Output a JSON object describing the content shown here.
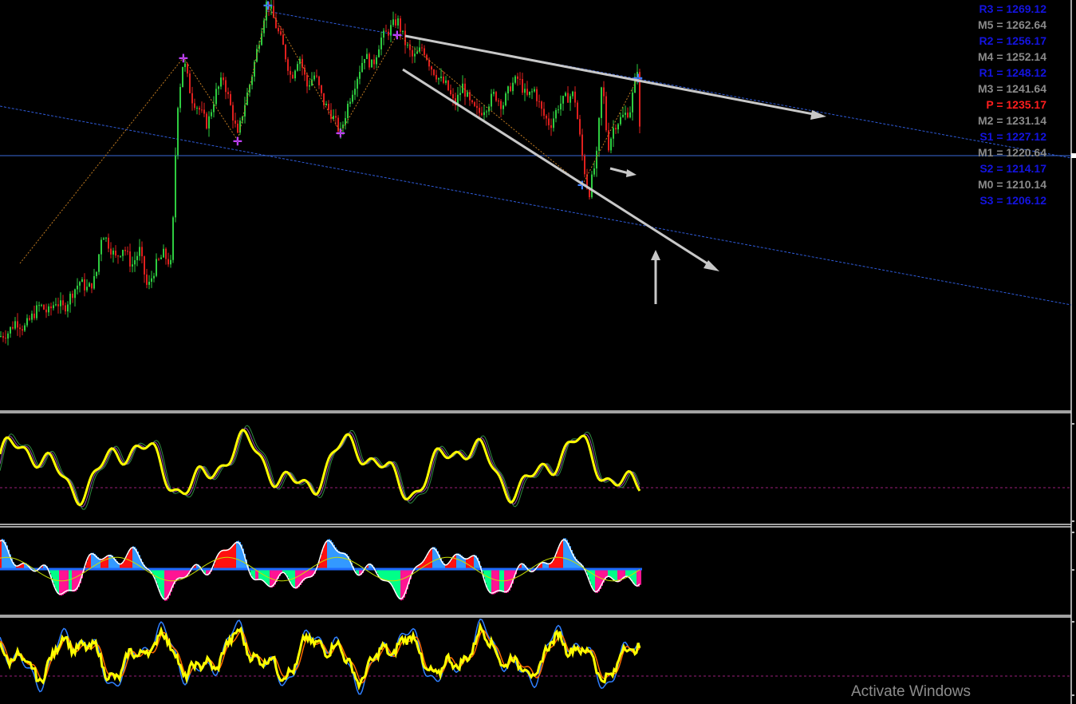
{
  "chart_data": [
    {
      "type": "candlestick",
      "panel": "price",
      "grid": false,
      "legend": "none",
      "colors": {
        "up": "#2ecc40",
        "down": "#e0201e",
        "background": "#000000",
        "channel": "#2f5bd9",
        "zigzag": "#c07a20"
      },
      "price_range": [
        1190,
        1290
      ],
      "close_path": [
        [
          0,
          1204
        ],
        [
          10,
          1205
        ],
        [
          20,
          1208
        ],
        [
          30,
          1206
        ],
        [
          40,
          1209
        ],
        [
          50,
          1212
        ],
        [
          60,
          1210
        ],
        [
          70,
          1213
        ],
        [
          80,
          1211
        ],
        [
          90,
          1215
        ],
        [
          100,
          1218
        ],
        [
          110,
          1216
        ],
        [
          120,
          1219
        ],
        [
          128,
          1231
        ],
        [
          135,
          1228
        ],
        [
          145,
          1224
        ],
        [
          155,
          1227
        ],
        [
          165,
          1222
        ],
        [
          175,
          1226
        ],
        [
          185,
          1216
        ],
        [
          195,
          1222
        ],
        [
          205,
          1225
        ],
        [
          215,
          1222
        ],
        [
          222,
          1262
        ],
        [
          230,
          1275
        ],
        [
          240,
          1265
        ],
        [
          250,
          1262
        ],
        [
          260,
          1258
        ],
        [
          270,
          1266
        ],
        [
          280,
          1270
        ],
        [
          290,
          1262
        ],
        [
          298,
          1255
        ],
        [
          305,
          1262
        ],
        [
          315,
          1270
        ],
        [
          325,
          1280
        ],
        [
          335,
          1290
        ],
        [
          345,
          1284
        ],
        [
          355,
          1278
        ],
        [
          365,
          1270
        ],
        [
          375,
          1276
        ],
        [
          385,
          1268
        ],
        [
          395,
          1271
        ],
        [
          405,
          1264
        ],
        [
          415,
          1261
        ],
        [
          427,
          1256
        ],
        [
          437,
          1264
        ],
        [
          447,
          1270
        ],
        [
          457,
          1276
        ],
        [
          467,
          1273
        ],
        [
          477,
          1280
        ],
        [
          487,
          1282
        ],
        [
          498,
          1285
        ],
        [
          508,
          1279
        ],
        [
          518,
          1275
        ],
        [
          530,
          1278
        ],
        [
          540,
          1273
        ],
        [
          550,
          1270
        ],
        [
          560,
          1268
        ],
        [
          570,
          1263
        ],
        [
          580,
          1268
        ],
        [
          590,
          1263
        ],
        [
          600,
          1261
        ],
        [
          610,
          1263
        ],
        [
          620,
          1266
        ],
        [
          630,
          1263
        ],
        [
          640,
          1268
        ],
        [
          650,
          1270
        ],
        [
          660,
          1265
        ],
        [
          670,
          1267
        ],
        [
          680,
          1261
        ],
        [
          690,
          1258
        ],
        [
          700,
          1263
        ],
        [
          710,
          1265
        ],
        [
          720,
          1266
        ],
        [
          730,
          1250
        ],
        [
          738,
          1240
        ],
        [
          748,
          1250
        ],
        [
          755,
          1270
        ],
        [
          762,
          1252
        ],
        [
          770,
          1258
        ],
        [
          780,
          1260
        ],
        [
          790,
          1262
        ],
        [
          800,
          1274
        ],
        [
          803,
          1248
        ]
      ],
      "pivot_levels": [
        {
          "label": "R3 = 1269.12",
          "value": 1269.12,
          "color": "#1414e0"
        },
        {
          "label": "M5 = 1262.64",
          "value": 1262.64,
          "color": "#8a8a8a"
        },
        {
          "label": "R2 = 1256.17",
          "value": 1256.17,
          "color": "#1414e0"
        },
        {
          "label": "M4 = 1252.14",
          "value": 1252.14,
          "color": "#8a8a8a"
        },
        {
          "label": "R1 = 1248.12",
          "value": 1248.12,
          "color": "#1414e0"
        },
        {
          "label": "M3 = 1241.64",
          "value": 1241.64,
          "color": "#8a8a8a"
        },
        {
          "label": "P   = 1235.17",
          "value": 1235.17,
          "color": "#ff1e1e"
        },
        {
          "label": "M2 = 1231.14",
          "value": 1231.14,
          "color": "#8a8a8a"
        },
        {
          "label": "S1 = 1227.12",
          "value": 1227.12,
          "color": "#1414e0"
        },
        {
          "label": "M1 = 1220.64",
          "value": 1220.64,
          "color": "#8a8a8a"
        },
        {
          "label": "S2 = 1214.17",
          "value": 1214.17,
          "color": "#1414e0"
        },
        {
          "label": "M0 = 1210.14",
          "value": 1210.14,
          "color": "#8a8a8a"
        },
        {
          "label": "S3 = 1206.12",
          "value": 1206.12,
          "color": "#1414e0"
        }
      ]
    },
    {
      "type": "line",
      "panel": "oscillator-1",
      "series": [
        {
          "color": "#ffff00"
        },
        {
          "color": "#9a4fb0"
        },
        {
          "color": "#2e8b3e"
        }
      ],
      "level_color": "#9a1e7a"
    },
    {
      "type": "area",
      "panel": "oscillator-2",
      "series": [
        {
          "color": "#ff1010"
        },
        {
          "color": "#00ff88"
        },
        {
          "color": "#ff1493"
        },
        {
          "color": "#3399ff"
        }
      ],
      "zero_color": "#1e6bff"
    },
    {
      "type": "line",
      "panel": "oscillator-3",
      "series": [
        {
          "color": "#ffff00"
        },
        {
          "color": "#2f7fff"
        },
        {
          "color": "#ff6a00"
        }
      ],
      "level_color": "#9a1e7a"
    }
  ],
  "watermark": "Activate Windows"
}
